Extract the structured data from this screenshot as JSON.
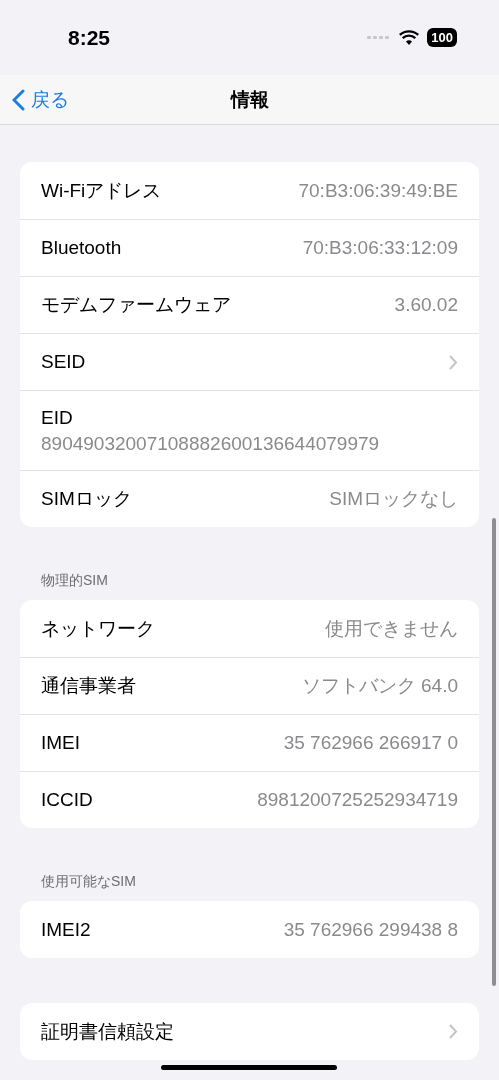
{
  "status_bar": {
    "time": "8:25",
    "battery": "100"
  },
  "nav_bar": {
    "back": "戻る",
    "title": "情報"
  },
  "sections": [
    {
      "rows": [
        {
          "kind": "value",
          "label": "Wi-Fiアドレス",
          "value": "70:B3:06:39:49:BE"
        },
        {
          "kind": "value",
          "label": "Bluetooth",
          "value": "70:B3:06:33:12:09"
        },
        {
          "kind": "value",
          "label": "モデムファームウェア",
          "value": "3.60.02"
        },
        {
          "kind": "chevron",
          "label": "SEID"
        },
        {
          "kind": "stacked",
          "label": "EID",
          "value": "89049032007108882600136644079979"
        },
        {
          "kind": "value",
          "label": "SIMロック",
          "value": "SIMロックなし"
        }
      ]
    },
    {
      "header": "物理的SIM",
      "rows": [
        {
          "kind": "value",
          "label": "ネットワーク",
          "value": "使用できません"
        },
        {
          "kind": "value",
          "label": "通信事業者",
          "value": "ソフトバンク 64.0"
        },
        {
          "kind": "value",
          "label": "IMEI",
          "value": "35 762966 266917 0"
        },
        {
          "kind": "value",
          "label": "ICCID",
          "value": "8981200725252934719"
        }
      ]
    },
    {
      "header": "使用可能なSIM",
      "rows": [
        {
          "kind": "value",
          "label": "IMEI2",
          "value": "35 762966 299438 8"
        }
      ]
    },
    {
      "rows": [
        {
          "kind": "chevron",
          "label": "証明書信頼設定"
        }
      ]
    }
  ]
}
